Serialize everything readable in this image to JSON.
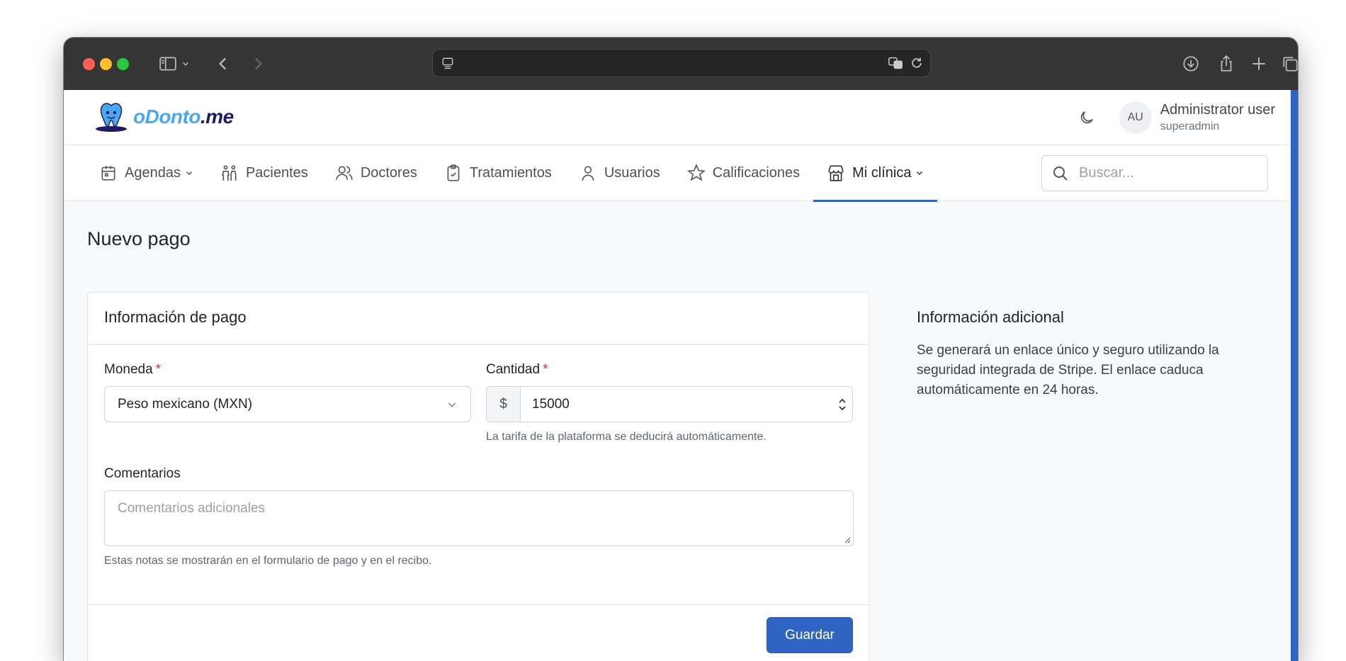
{
  "app": {
    "logo_text_a": "oDonto",
    "logo_text_b": ".me",
    "brand_color": "#4aa8f0",
    "brand_dark": "#1e1a63",
    "accent_color": "#2f64c2"
  },
  "user": {
    "initials": "AU",
    "name": "Administrator user",
    "role": "superadmin"
  },
  "nav": {
    "items": [
      {
        "label": "Agendas",
        "icon": "calendar-icon",
        "dropdown": true
      },
      {
        "label": "Pacientes",
        "icon": "people-icon"
      },
      {
        "label": "Doctores",
        "icon": "users-icon"
      },
      {
        "label": "Tratamientos",
        "icon": "clipboard-icon"
      },
      {
        "label": "Usuarios",
        "icon": "user-icon"
      },
      {
        "label": "Calificaciones",
        "icon": "star-icon"
      },
      {
        "label": "Mi clínica",
        "icon": "store-icon",
        "dropdown": true,
        "active": true
      }
    ],
    "search_placeholder": "Buscar..."
  },
  "page": {
    "title": "Nuevo pago"
  },
  "form": {
    "header": "Información de pago",
    "currency_label": "Moneda",
    "currency_value": "Peso mexicano (MXN)",
    "amount_label": "Cantidad",
    "amount_prefix": "$",
    "amount_value": "15000",
    "amount_help": "La tarifa de la plataforma se deducirá automáticamente.",
    "comments_label": "Comentarios",
    "comments_placeholder": "Comentarios adicionales",
    "comments_help": "Estas notas se mostrarán en el formulario de pago y en el recibo.",
    "required_mark": "*",
    "save_label": "Guardar"
  },
  "aside": {
    "title": "Información adicional",
    "text": "Se generará un enlace único y seguro utilizando la seguridad integrada de Stripe. El enlace caduca automáticamente en 24 horas."
  }
}
